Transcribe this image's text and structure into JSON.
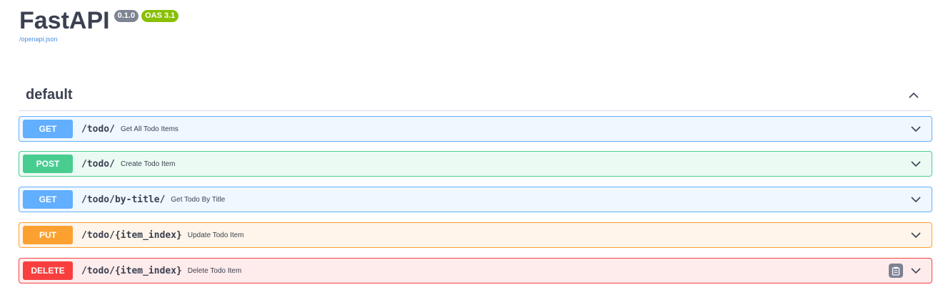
{
  "info": {
    "title": "FastAPI",
    "version": "0.1.0",
    "oas": "OAS 3.1",
    "spec_link": "/openapi.json"
  },
  "tag": {
    "name": "default"
  },
  "operations": [
    {
      "method": "GET",
      "path": "/todo/",
      "summary": "Get All Todo Items"
    },
    {
      "method": "POST",
      "path": "/todo/",
      "summary": "Create Todo Item"
    },
    {
      "method": "GET",
      "path": "/todo/by-title/",
      "summary": "Get Todo By Title"
    },
    {
      "method": "PUT",
      "path": "/todo/{item_index}",
      "summary": "Update Todo Item"
    },
    {
      "method": "DELETE",
      "path": "/todo/{item_index}",
      "summary": "Delete Todo Item"
    }
  ],
  "icons": {
    "tag_toggle": "chevron-up-icon",
    "expand": "chevron-down-icon",
    "copy": "clipboard-icon"
  },
  "colors": {
    "get": "#61affe",
    "post": "#49cc90",
    "put": "#fca130",
    "delete": "#f93e3e",
    "link": "#4990e2",
    "oas_badge": "#89bf04",
    "version_badge": "#7d8492"
  }
}
